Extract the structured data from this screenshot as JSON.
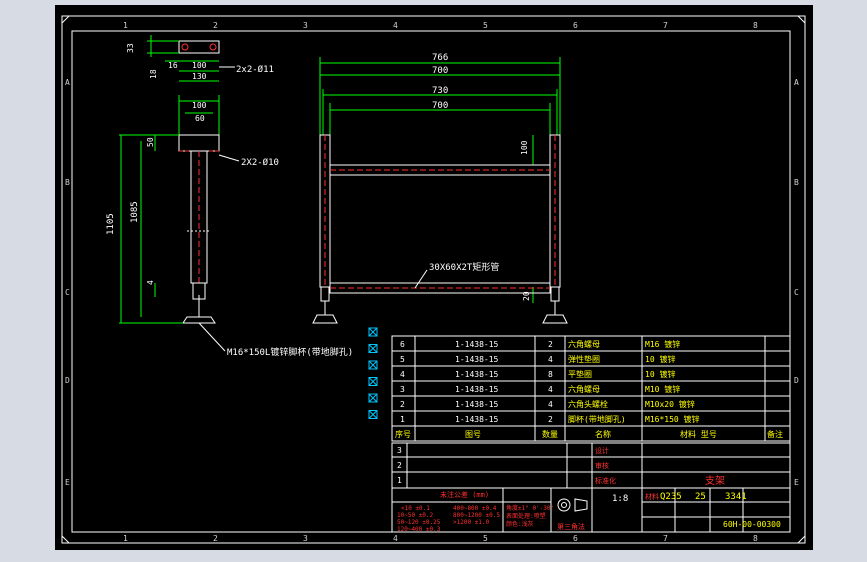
{
  "border": {
    "col_numbers": [
      "1",
      "2",
      "3",
      "4",
      "5",
      "6",
      "7",
      "8"
    ],
    "row_letters": [
      "A",
      "B",
      "C",
      "D",
      "E"
    ]
  },
  "side_view": {
    "dims": [
      "33",
      "16",
      "18",
      "100",
      "130",
      "100",
      "60",
      "50",
      "1105",
      "1085",
      "4"
    ],
    "label_holes": "2x2-Ø11",
    "label_plate": "2X2-Ø10",
    "label_foot": "M16*150L镀锌脚杯(带地脚孔)"
  },
  "front_view": {
    "dims": [
      "766",
      "700",
      "730",
      "700",
      "100",
      "20"
    ],
    "label_tube": "30X60X2T矩形管"
  },
  "bom": {
    "rows": [
      {
        "no": "6",
        "code": "1-1438-15",
        "qty": "2",
        "name": "六角螺母",
        "material": "M16 镀锌"
      },
      {
        "no": "5",
        "code": "1-1438-15",
        "qty": "4",
        "name": "弹性垫圈",
        "material": "10 镀锌"
      },
      {
        "no": "4",
        "code": "1-1438-15",
        "qty": "8",
        "name": "平垫圈",
        "material": "10 镀锌"
      },
      {
        "no": "3",
        "code": "1-1438-15",
        "qty": "4",
        "name": "六角螺母",
        "material": "M10 镀锌"
      },
      {
        "no": "2",
        "code": "1-1438-15",
        "qty": "4",
        "name": "六角头螺栓",
        "material": "M10x20 镀锌"
      },
      {
        "no": "1",
        "code": "1-1438-15",
        "qty": "2",
        "name": "脚杯(带地脚孔)",
        "material": "M16*150 镀锌"
      }
    ],
    "header": {
      "no": "序号",
      "code": "图号",
      "qty": "数量",
      "name": "名称",
      "material": "材料 型号",
      "remark": "备注"
    }
  },
  "title_block": {
    "title": "支架",
    "rev_labels": [
      "3",
      "2",
      "1"
    ],
    "scale": "1:8",
    "material_label": "材料",
    "material_value": "Q235",
    "weight": "25",
    "code": "3341",
    "drawing_no": "60H-00-00300",
    "view_label": "第三角法",
    "tol_header": "未注公差 (mm)",
    "tol_rows": [
      "<10 ±0.1",
      "10~50 ±0.2",
      "50~120 ±0.25",
      "120~400 ±0.3"
    ],
    "tol_rows2": [
      "400~800 ±0.4",
      "800~1200 ±0.5",
      ">1200 ±1.0"
    ],
    "angle_tol": "角度±1° 0'-30'",
    "surface": "表面处理:喷塑",
    "color": "颜色:浅灰",
    "cells": [
      "设计",
      "审核",
      "标准化",
      "工艺",
      "日期",
      "批准",
      "重量",
      "比例",
      "共 张",
      "第 张"
    ]
  }
}
